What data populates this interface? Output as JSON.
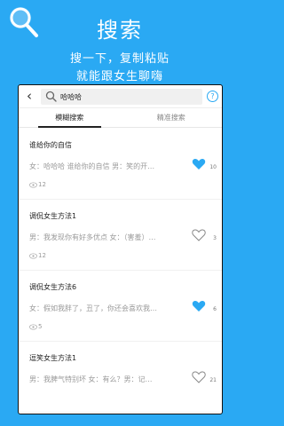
{
  "hero": {
    "title": "搜索",
    "line1": "搜一下，复制粘贴",
    "line2": "就能跟女生聊嗨"
  },
  "colors": {
    "brand": "#2aa9f3",
    "like_filled": "#2aa9f3"
  },
  "search": {
    "value": "哈哈哈",
    "placeholder": ""
  },
  "help_label": "?",
  "back_label": "‹",
  "tabs": [
    {
      "label": "模糊搜索",
      "active": true
    },
    {
      "label": "精准搜索",
      "active": false
    }
  ],
  "items": [
    {
      "title": "谁给你的自信",
      "content": "女：哈哈哈 谁给你的自信 男：笑的开…",
      "likes": "10",
      "liked": true,
      "views": "12"
    },
    {
      "title": "调侃女生方法1",
      "content": "男：我发现你有好多优点 女：（害羞）…",
      "likes": "3",
      "liked": false,
      "views": "12"
    },
    {
      "title": "调侃女生方法6",
      "content": "女：假如我胖了，丑了，你还会喜欢我…",
      "likes": "6",
      "liked": true,
      "views": "5"
    },
    {
      "title": "逗笑女生方法1",
      "content": "男：我脾气特别坏 女：有么？男：记…",
      "likes": "21",
      "liked": false,
      "views": ""
    }
  ]
}
